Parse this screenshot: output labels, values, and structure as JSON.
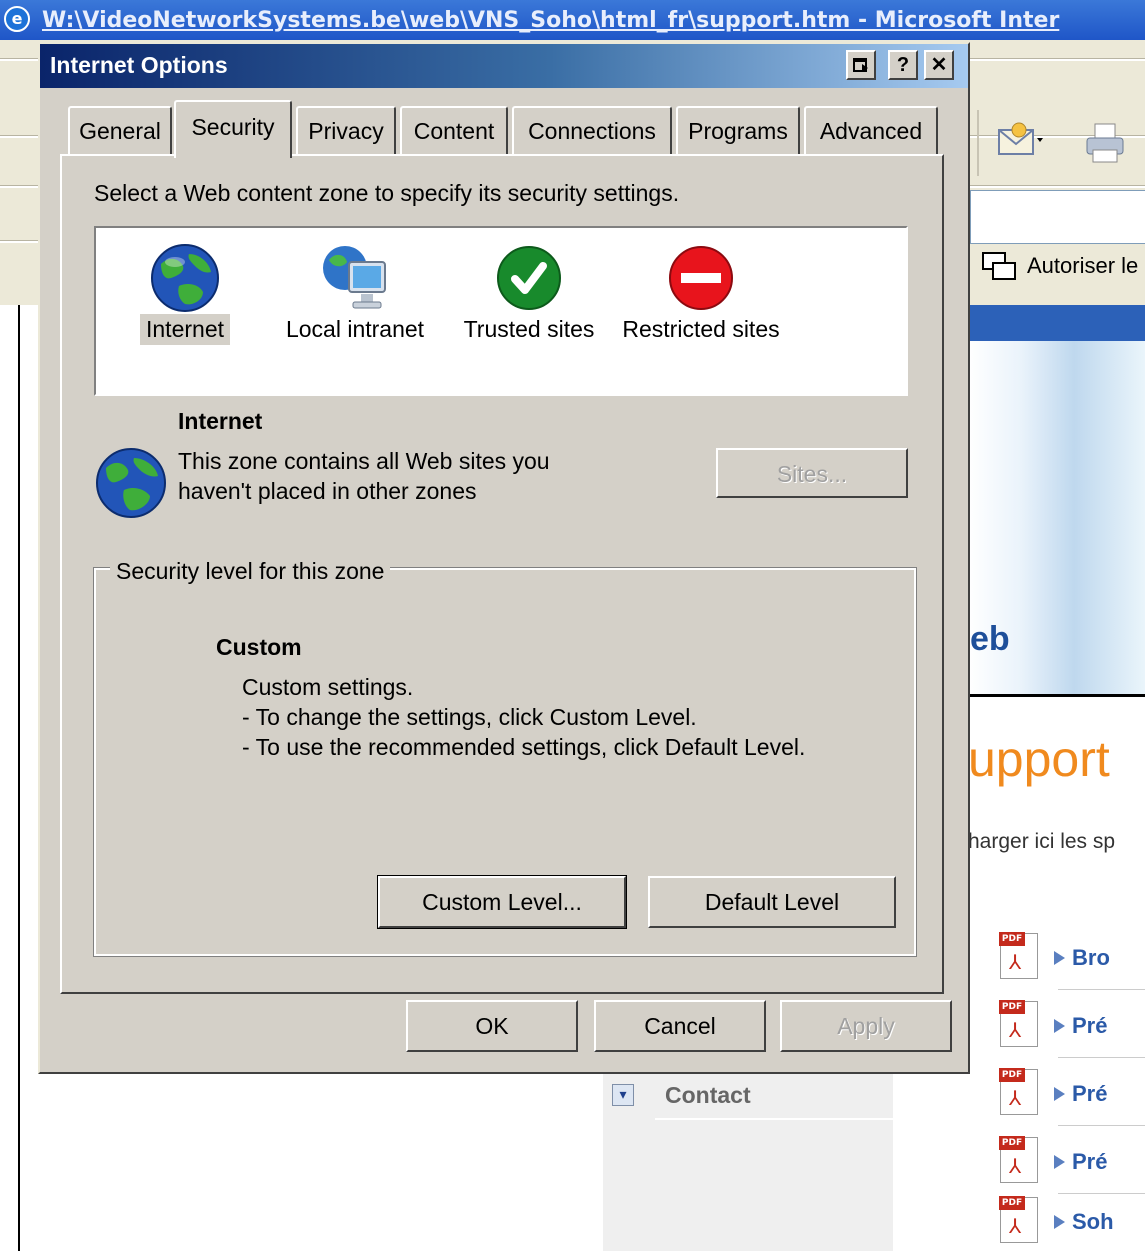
{
  "browser": {
    "title": "W:\\VideoNetworkSystems.be\\web\\VNS_Soho\\html_fr\\support.htm - Microsoft Inter",
    "authorize_label": "Autoriser le",
    "banner_text": "eb",
    "support_title": "upport",
    "support_desc": "harger ici les sp",
    "nav_contact": "Contact",
    "documents": [
      {
        "label": "Bro"
      },
      {
        "label": "Pré"
      },
      {
        "label": "Pré"
      },
      {
        "label": "Pré"
      },
      {
        "label": "Soh"
      }
    ],
    "pdf_badge": "PDF",
    "colors": {
      "support_orange": "#f08a1e",
      "link_blue": "#2b5aa8",
      "header_blue": "#2c61b8"
    }
  },
  "dialog": {
    "title": "Internet Options",
    "title_buttons": {
      "help": "?",
      "close": "✕"
    },
    "tabs": [
      {
        "label": "General"
      },
      {
        "label": "Security"
      },
      {
        "label": "Privacy"
      },
      {
        "label": "Content"
      },
      {
        "label": "Connections"
      },
      {
        "label": "Programs"
      },
      {
        "label": "Advanced"
      }
    ],
    "active_tab": "Security",
    "zone_instruction": "Select a Web content zone to specify its security settings.",
    "zones": [
      {
        "label": "Internet",
        "icon": "globe-icon"
      },
      {
        "label": "Local intranet",
        "icon": "intranet-icon"
      },
      {
        "label": "Trusted sites",
        "icon": "trusted-check-icon"
      },
      {
        "label": "Restricted sites",
        "icon": "restricted-icon"
      }
    ],
    "selected_zone": {
      "name": "Internet",
      "description": "This zone contains all Web sites you haven't placed in other zones"
    },
    "sites_button": "Sites...",
    "security_group_label": "Security level for this zone",
    "security_level": "Custom",
    "security_desc": "Custom settings.\n- To change the settings, click Custom Level.\n- To use the recommended settings, click Default Level.",
    "custom_level_button": "Custom Level...",
    "default_level_button": "Default Level",
    "ok_button": "OK",
    "cancel_button": "Cancel",
    "apply_button": "Apply"
  }
}
